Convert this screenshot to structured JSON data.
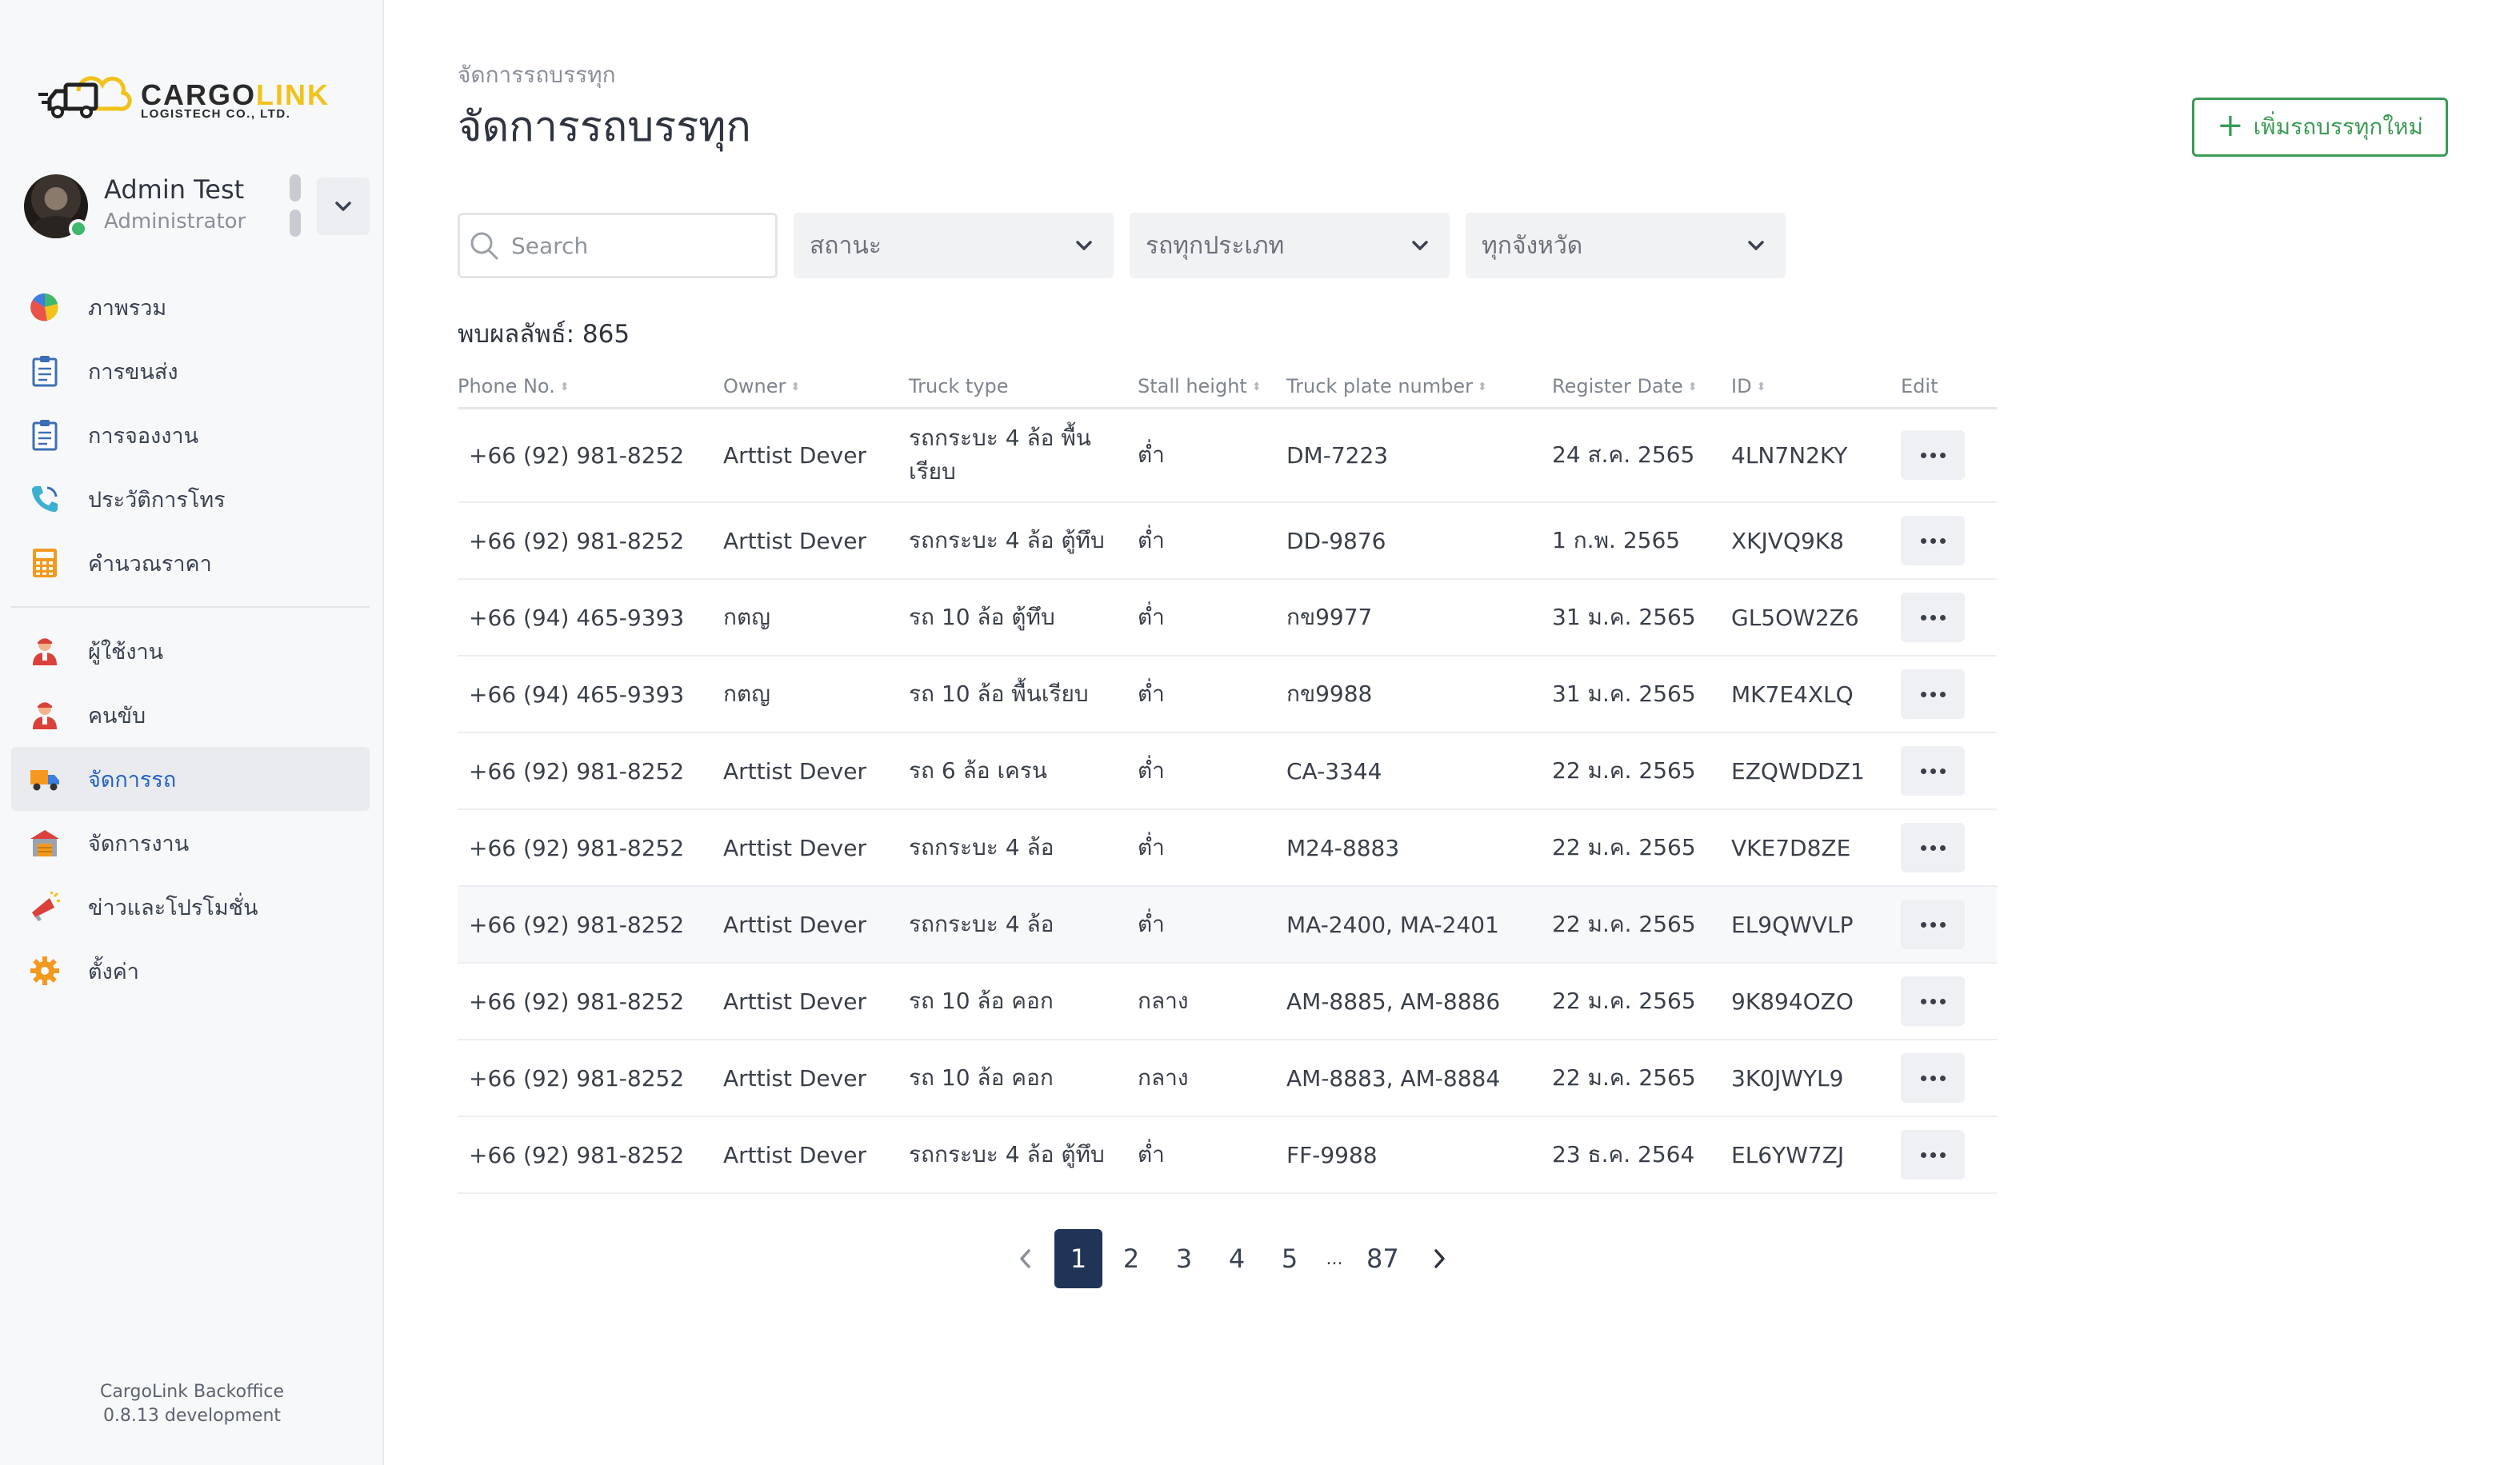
{
  "brand": {
    "word_main": "CARGO",
    "word_accent": "LINK",
    "subtitle": "LOGISTECH CO., LTD."
  },
  "profile": {
    "name": "Admin Test",
    "role": "Administrator",
    "online_color": "#3fb86b"
  },
  "nav": {
    "group1": [
      {
        "label": "ภาพรวม",
        "icon": "pie-chart-icon"
      },
      {
        "label": "การขนส่ง",
        "icon": "clipboard-icon"
      },
      {
        "label": "การจองงาน",
        "icon": "clipboard-icon"
      },
      {
        "label": "ประวัติการโทร",
        "icon": "phone-icon"
      },
      {
        "label": "คำนวณราคา",
        "icon": "calculator-icon"
      }
    ],
    "group2": [
      {
        "label": "ผู้ใช้งาน",
        "icon": "user-icon"
      },
      {
        "label": "คนขับ",
        "icon": "driver-icon"
      },
      {
        "label": "จัดการรถ",
        "icon": "truck-icon",
        "active": true
      },
      {
        "label": "จัดการงาน",
        "icon": "warehouse-icon"
      },
      {
        "label": "ข่าวและโปรโมชั่น",
        "icon": "megaphone-icon"
      },
      {
        "label": "ตั้งค่า",
        "icon": "gear-icon"
      }
    ]
  },
  "footer": {
    "app_name": "CargoLink Backoffice",
    "version": "0.8.13 development"
  },
  "page": {
    "breadcrumb": "จัดการรถบรรทุก",
    "title": "จัดการรถบรรทุก",
    "add_button": "เพิ่มรถบรรทุกใหม่"
  },
  "filters": {
    "search_placeholder": "Search",
    "status_select": "สถานะ",
    "type_select": "รถทุกประเภท",
    "province_select": "ทุกจังหวัด"
  },
  "results_label": "พบผลลัพธ์: 865",
  "table": {
    "headers": {
      "phone": "Phone No.",
      "owner": "Owner",
      "truck_type": "Truck type",
      "stall_height": "Stall height",
      "plate": "Truck plate number",
      "register_date": "Register Date",
      "id": "ID",
      "edit": "Edit"
    },
    "rows": [
      {
        "phone": "+66 (92) 981-8252",
        "owner": "Arttist Dever",
        "truck_type": "รถกระบะ 4 ล้อ พื้นเรียบ",
        "stall_height": "ต่ำ",
        "plate": "DM-7223",
        "register_date": "24 ส.ค. 2565",
        "id": "4LN7N2KY"
      },
      {
        "phone": "+66 (92) 981-8252",
        "owner": "Arttist Dever",
        "truck_type": "รถกระบะ 4 ล้อ ตู้ทึบ",
        "stall_height": "ต่ำ",
        "plate": "DD-9876",
        "register_date": "1 ก.พ. 2565",
        "id": "XKJVQ9K8"
      },
      {
        "phone": "+66 (94) 465-9393",
        "owner": "กตญ",
        "truck_type": "รถ 10 ล้อ ตู้ทึบ",
        "stall_height": "ต่ำ",
        "plate": "กข9977",
        "register_date": "31 ม.ค. 2565",
        "id": "GL5OW2Z6"
      },
      {
        "phone": "+66 (94) 465-9393",
        "owner": "กตญ",
        "truck_type": "รถ 10 ล้อ พื้นเรียบ",
        "stall_height": "ต่ำ",
        "plate": "กข9988",
        "register_date": "31 ม.ค. 2565",
        "id": "MK7E4XLQ"
      },
      {
        "phone": "+66 (92) 981-8252",
        "owner": "Arttist Dever",
        "truck_type": "รถ 6 ล้อ เครน",
        "stall_height": "ต่ำ",
        "plate": "CA-3344",
        "register_date": "22 ม.ค. 2565",
        "id": "EZQWDDZ1"
      },
      {
        "phone": "+66 (92) 981-8252",
        "owner": "Arttist Dever",
        "truck_type": "รถกระบะ 4 ล้อ",
        "stall_height": "ต่ำ",
        "plate": "M24-8883",
        "register_date": "22 ม.ค. 2565",
        "id": "VKE7D8ZE"
      },
      {
        "phone": "+66 (92) 981-8252",
        "owner": "Arttist Dever",
        "truck_type": "รถกระบะ 4 ล้อ",
        "stall_height": "ต่ำ",
        "plate": "MA-2400, MA-2401",
        "register_date": "22 ม.ค. 2565",
        "id": "EL9QWVLP"
      },
      {
        "phone": "+66 (92) 981-8252",
        "owner": "Arttist Dever",
        "truck_type": "รถ 10 ล้อ คอก",
        "stall_height": "กลาง",
        "plate": "AM-8885, AM-8886",
        "register_date": "22 ม.ค. 2565",
        "id": "9K894OZO"
      },
      {
        "phone": "+66 (92) 981-8252",
        "owner": "Arttist Dever",
        "truck_type": "รถ 10 ล้อ คอก",
        "stall_height": "กลาง",
        "plate": "AM-8883, AM-8884",
        "register_date": "22 ม.ค. 2565",
        "id": "3K0JWYL9"
      },
      {
        "phone": "+66 (92) 981-8252",
        "owner": "Arttist Dever",
        "truck_type": "รถกระบะ 4 ล้อ ตู้ทึบ",
        "stall_height": "ต่ำ",
        "plate": "FF-9988",
        "register_date": "23 ธ.ค. 2564",
        "id": "EL6YW7ZJ"
      }
    ]
  },
  "pagination": {
    "pages": [
      "1",
      "2",
      "3",
      "4",
      "5",
      "...",
      "87"
    ],
    "current": "1"
  },
  "colors": {
    "accent_green": "#3a9b55",
    "active_page": "#1f3457",
    "active_nav_text": "#2563c4"
  }
}
